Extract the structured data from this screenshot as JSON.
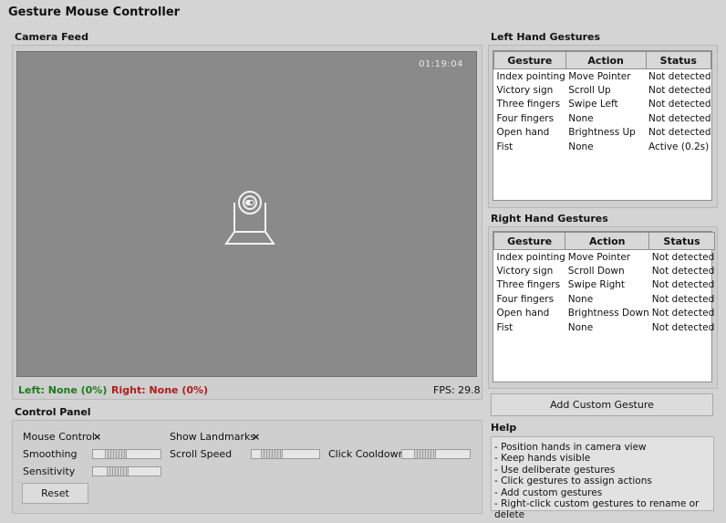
{
  "window": {
    "title": "Gesture Mouse Controller"
  },
  "camera": {
    "title": "Camera Feed",
    "timestamp": "01:19:04",
    "left_status": "Left: None (0%)",
    "right_status": "Right: None (0%)",
    "fps": "FPS: 29.8",
    "icon": "webcam-icon"
  },
  "control_panel": {
    "title": "Control Panel",
    "mouse_control": {
      "label": "Mouse Control",
      "mark": "×"
    },
    "show_landmarks": {
      "label": "Show Landmarks",
      "mark": "×"
    },
    "smoothing": {
      "label": "Smoothing",
      "value": 0.25
    },
    "scroll_speed": {
      "label": "Scroll Speed",
      "value": 0.2
    },
    "click_cooldown": {
      "label": "Click Cooldown",
      "value": 0.25
    },
    "sensitivity": {
      "label": "Sensitivity",
      "value": 0.3
    },
    "reset_label": "Reset"
  },
  "left_gestures": {
    "title": "Left Hand Gestures",
    "columns": [
      "Gesture",
      "Action",
      "Status"
    ],
    "rows": [
      [
        "Index pointing",
        "Move Pointer",
        "Not detected"
      ],
      [
        "Victory sign",
        "Scroll Up",
        "Not detected"
      ],
      [
        "Three fingers",
        "Swipe Left",
        "Not detected"
      ],
      [
        "Four fingers",
        "None",
        "Not detected"
      ],
      [
        "Open hand",
        "Brightness Up",
        "Not detected"
      ],
      [
        "Fist",
        "None",
        "Active (0.2s)"
      ]
    ]
  },
  "right_gestures": {
    "title": "Right Hand Gestures",
    "columns": [
      "Gesture",
      "Action",
      "Status"
    ],
    "rows": [
      [
        "Index pointing",
        "Move Pointer",
        "Not detected"
      ],
      [
        "Victory sign",
        "Scroll Down",
        "Not detected"
      ],
      [
        "Three fingers",
        "Swipe Right",
        "Not detected"
      ],
      [
        "Four fingers",
        "None",
        "Not detected"
      ],
      [
        "Open hand",
        "Brightness Down",
        "Not detected"
      ],
      [
        "Fist",
        "None",
        "Not detected"
      ]
    ]
  },
  "add_gesture_label": "Add Custom Gesture",
  "help": {
    "title": "Help",
    "lines": [
      "- Position hands in camera view",
      "- Keep hands visible",
      "- Use deliberate gestures",
      "- Click gestures to assign actions",
      "- Add custom gestures",
      "- Right-click custom gestures to rename or delete"
    ]
  }
}
